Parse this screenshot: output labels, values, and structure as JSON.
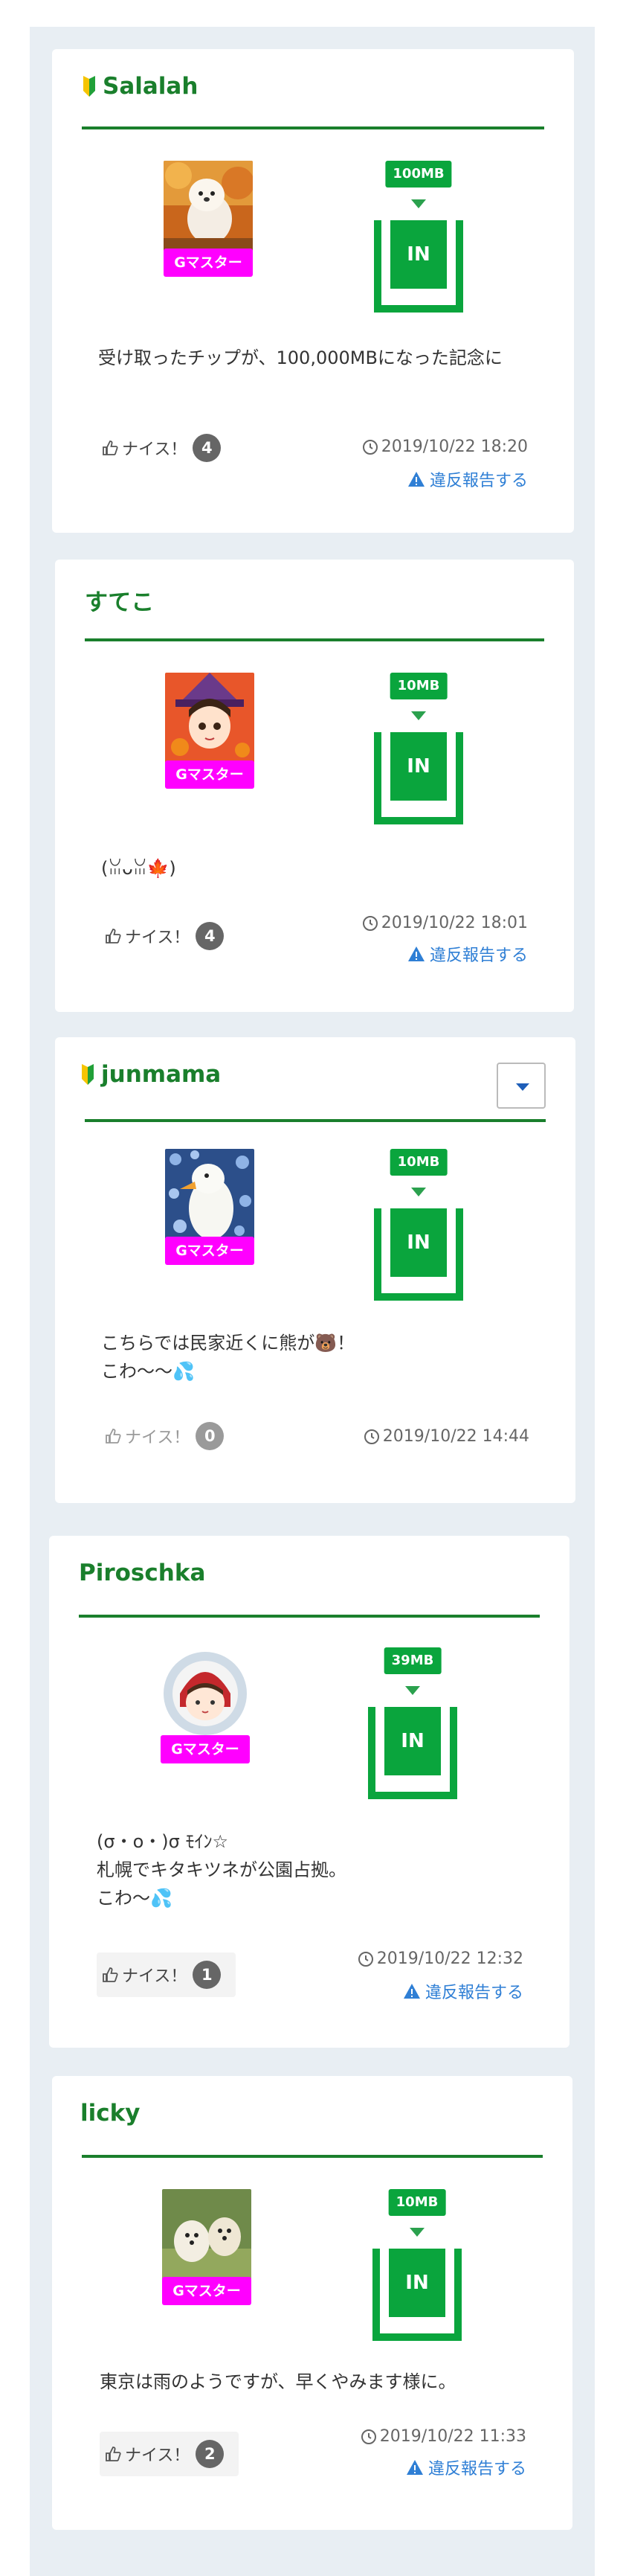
{
  "posts": [
    {
      "name": "Salalah",
      "beginner": true,
      "badge": "Gマスター",
      "mb": "100MB",
      "in_label": "IN",
      "message": "受け取ったチップが、100,000MBになった記念に",
      "nice_label": "ナイス！",
      "nice_count": "4",
      "timestamp": "2019/10/22 18:20",
      "report_label": "違反報告する"
    },
    {
      "name": "すてこ",
      "beginner": false,
      "badge": "Gマスター",
      "mb": "10MB",
      "in_label": "IN",
      "message": "(ꈍᴗꈍ🍁)",
      "nice_label": "ナイス！",
      "nice_count": "4",
      "timestamp": "2019/10/22 18:01",
      "report_label": "違反報告する"
    },
    {
      "name": "junmama",
      "beginner": true,
      "badge": "Gマスター",
      "mb": "10MB",
      "in_label": "IN",
      "message_lines": [
        "こちらでは民家近くに熊が🐻！",
        "こわ〜〜💦"
      ],
      "nice_label": "ナイス！",
      "nice_count": "0",
      "timestamp": "2019/10/22 14:44"
    },
    {
      "name": "Piroschka",
      "beginner": false,
      "badge": "Gマスター",
      "mb": "39MB",
      "in_label": "IN",
      "message_lines": [
        "(σ・o・)σ ﾓｲﾝ☆",
        "札幌でキタキツネが公園占拠。",
        "こわ〜💦"
      ],
      "nice_label": "ナイス！",
      "nice_count": "1",
      "timestamp": "2019/10/22 12:32",
      "report_label": "違反報告する"
    },
    {
      "name": "licky",
      "beginner": false,
      "badge": "Gマスター",
      "mb": "10MB",
      "in_label": "IN",
      "message": "東京は雨のようですが、早くやみます様に。",
      "nice_label": "ナイス！",
      "nice_count": "2",
      "timestamp": "2019/10/22 11:33",
      "report_label": "違反報告する"
    }
  ],
  "colors": {
    "brand_green": "#1a7f2c",
    "in_green": "#0aa53d",
    "badge_magenta": "#ff00ff",
    "report_blue": "#2f7fd5"
  },
  "icons": {
    "beginner": "beginner-mark-icon",
    "thumb": "thumbs-up-icon",
    "clock": "clock-icon",
    "warning": "warning-icon",
    "dropdown": "chevron-down-icon"
  }
}
